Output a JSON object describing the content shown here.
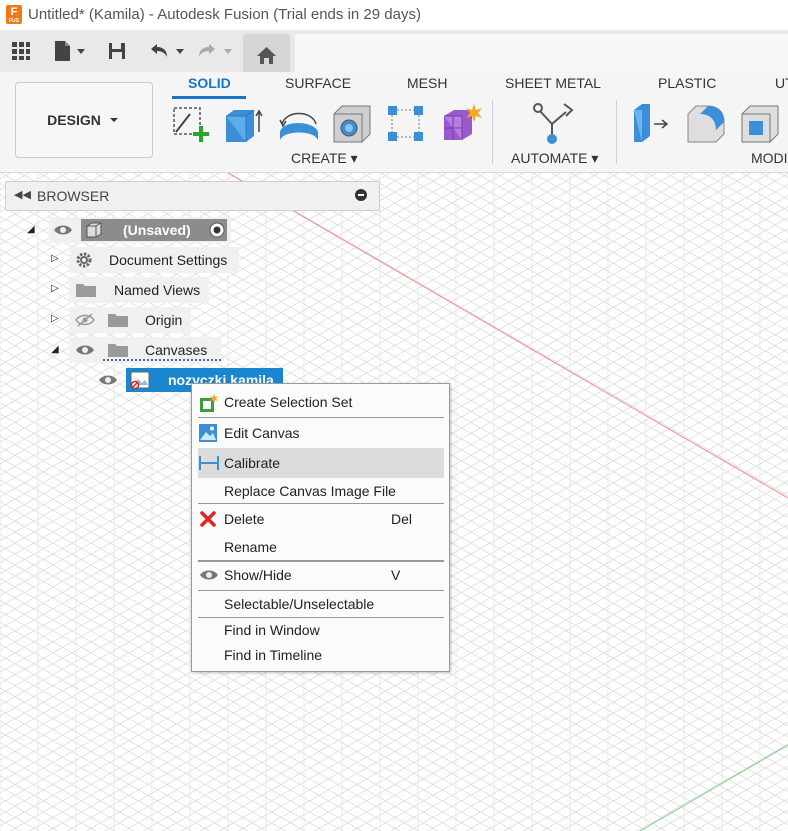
{
  "window": {
    "title": "Untitled* (Kamila) - Autodesk Fusion (Trial ends in 29 days)",
    "app_icon_letter": "F"
  },
  "ribbon": {
    "workspace": "DESIGN",
    "tabs": [
      "SOLID",
      "SURFACE",
      "MESH",
      "SHEET METAL",
      "PLASTIC",
      "UT"
    ],
    "active_tab": "SOLID",
    "groups": {
      "create": "CREATE",
      "automate": "AUTOMATE",
      "modify": "MODI"
    },
    "colors": {
      "accent": "#1b74c7"
    }
  },
  "browser": {
    "title": "BROWSER",
    "root": {
      "label": "(Unsaved)"
    },
    "items": [
      {
        "label": "Document Settings"
      },
      {
        "label": "Named Views"
      },
      {
        "label": "Origin"
      },
      {
        "label": "Canvases"
      }
    ],
    "selected_canvas": "nozyczki kamila"
  },
  "context_menu": {
    "items": [
      {
        "label": "Create Selection Set",
        "icon": "selection-set-icon"
      },
      {
        "label": "Edit Canvas",
        "icon": "canvas-image-icon"
      },
      {
        "label": "Calibrate",
        "icon": "calibrate-icon",
        "highlighted": true
      },
      {
        "label": "Replace Canvas Image File"
      },
      {
        "label": "Delete",
        "icon": "delete-x-icon",
        "shortcut": "Del"
      },
      {
        "label": "Rename"
      },
      {
        "label": "Show/Hide",
        "icon": "eye-icon",
        "shortcut": "V"
      },
      {
        "label": "Selectable/Unselectable"
      },
      {
        "label": "Find in Window"
      },
      {
        "label": "Find in Timeline"
      }
    ]
  }
}
